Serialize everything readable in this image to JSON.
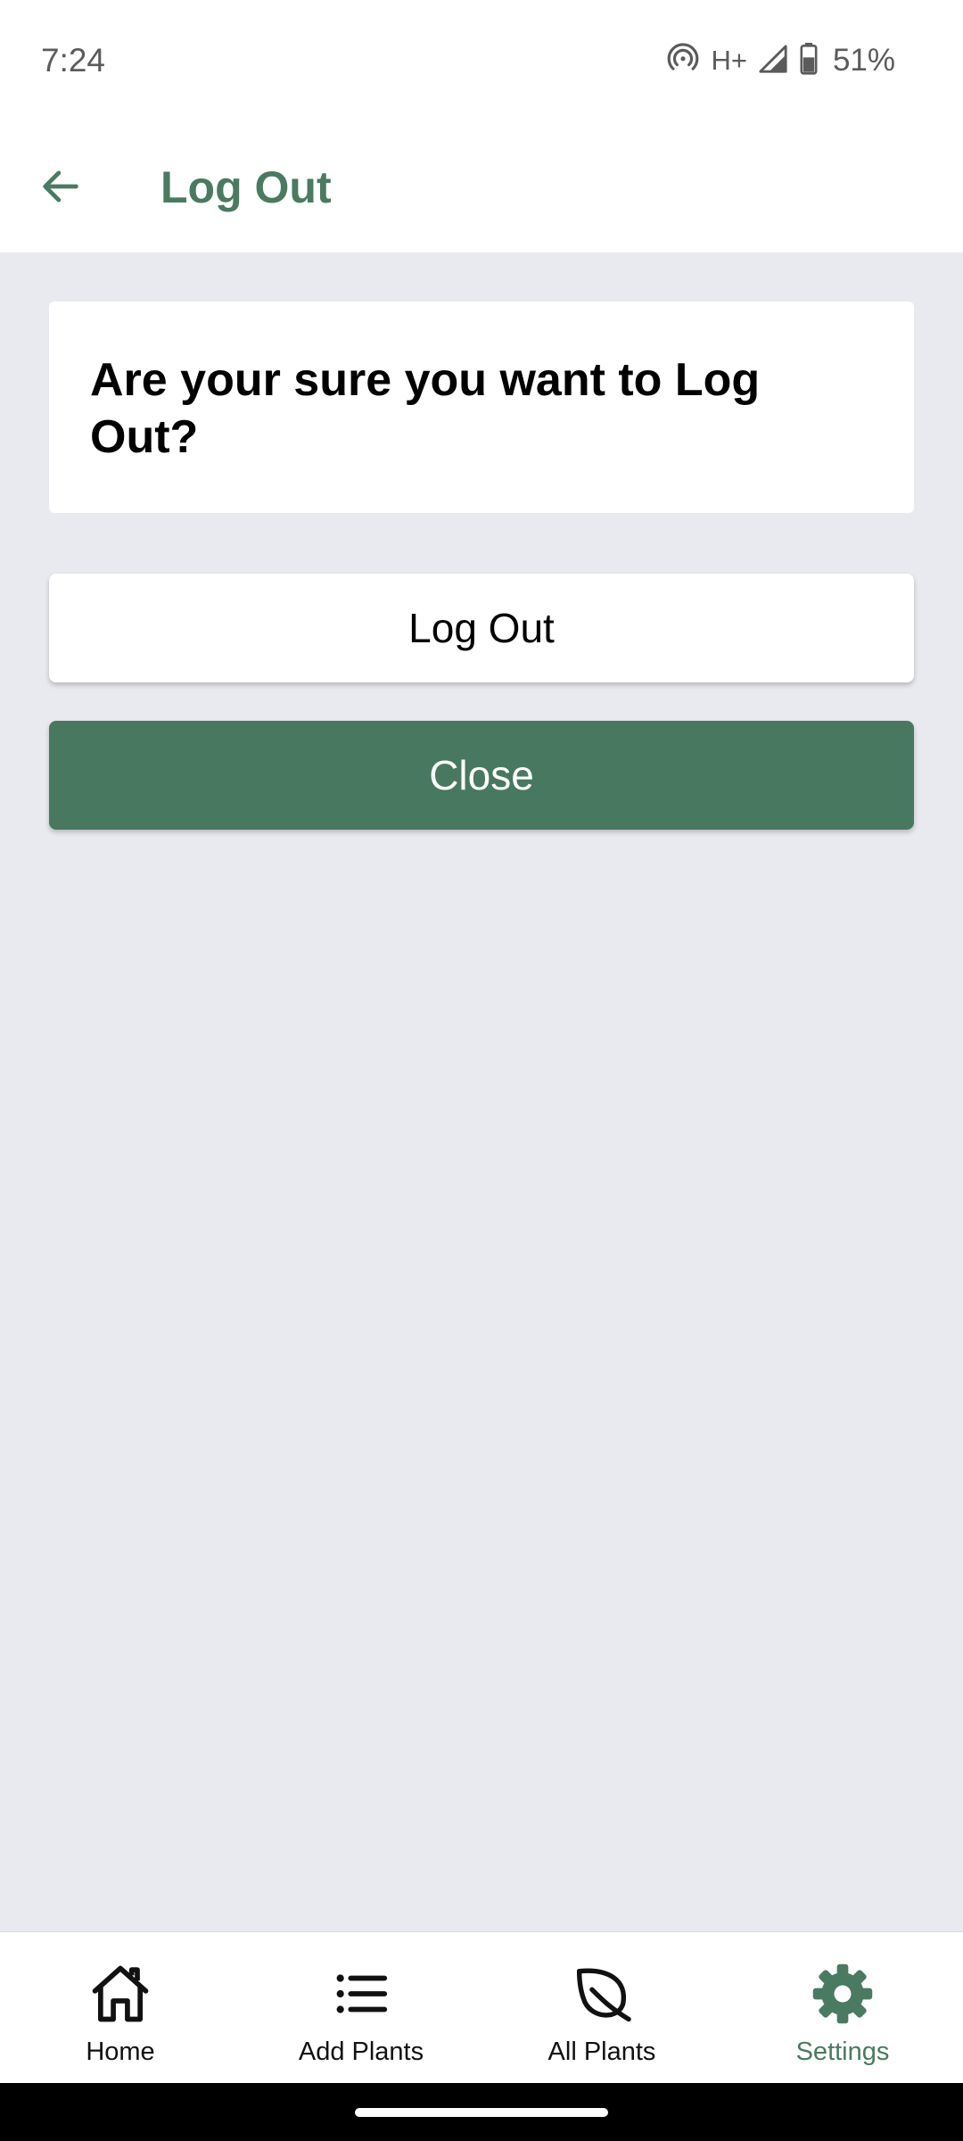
{
  "status_bar": {
    "time": "7:24",
    "network_type": "H+",
    "battery": "51%",
    "icons": [
      "hotspot-icon",
      "signal-icon",
      "battery-icon"
    ]
  },
  "app_bar": {
    "back_icon": "arrow-left-icon",
    "title": "Log Out"
  },
  "prompt": {
    "text": "Are your sure you want to Log Out?"
  },
  "buttons": {
    "logout_label": "Log Out",
    "close_label": "Close"
  },
  "bottom_nav": {
    "items": [
      {
        "label": "Home",
        "icon": "home-icon",
        "active": false
      },
      {
        "label": "Add Plants",
        "icon": "list-icon",
        "active": false
      },
      {
        "label": "All Plants",
        "icon": "leaf-icon",
        "active": false
      },
      {
        "label": "Settings",
        "icon": "gear-icon",
        "active": true
      }
    ]
  },
  "colors": {
    "accent": "#4a7a62",
    "close_button": "#497861",
    "background": "#e9eaef",
    "surface": "#ffffff"
  }
}
